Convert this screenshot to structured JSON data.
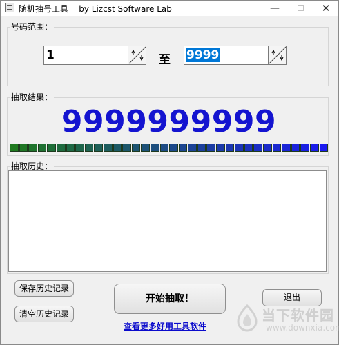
{
  "window": {
    "title": "随机抽号工具    by Lizcst Software Lab",
    "controls": {
      "minimize": "—",
      "maximize": "",
      "close": "✕"
    }
  },
  "range": {
    "label": "号码范围：",
    "from_value": "1",
    "to_label": "至",
    "to_value": "9999"
  },
  "result": {
    "label": "抽取结果：",
    "number": "9999999999",
    "progress_segments": 34,
    "progress_color_start": "#1f7a1f",
    "progress_color_end": "#1a1af0"
  },
  "history": {
    "label": "抽取历史：",
    "entries": []
  },
  "buttons": {
    "save_history": "保存历史记录",
    "clear_history": "清空历史记录",
    "start": "开始抽取！",
    "exit": "退出"
  },
  "link_text": "查看更多好用工具软件",
  "watermark": {
    "name": "当下软件园",
    "url": "www.downxia.com"
  },
  "icons": {
    "app": "app-window-icon",
    "spin": "spin-arrows-icon",
    "watermark": "downxia-logo-icon"
  }
}
